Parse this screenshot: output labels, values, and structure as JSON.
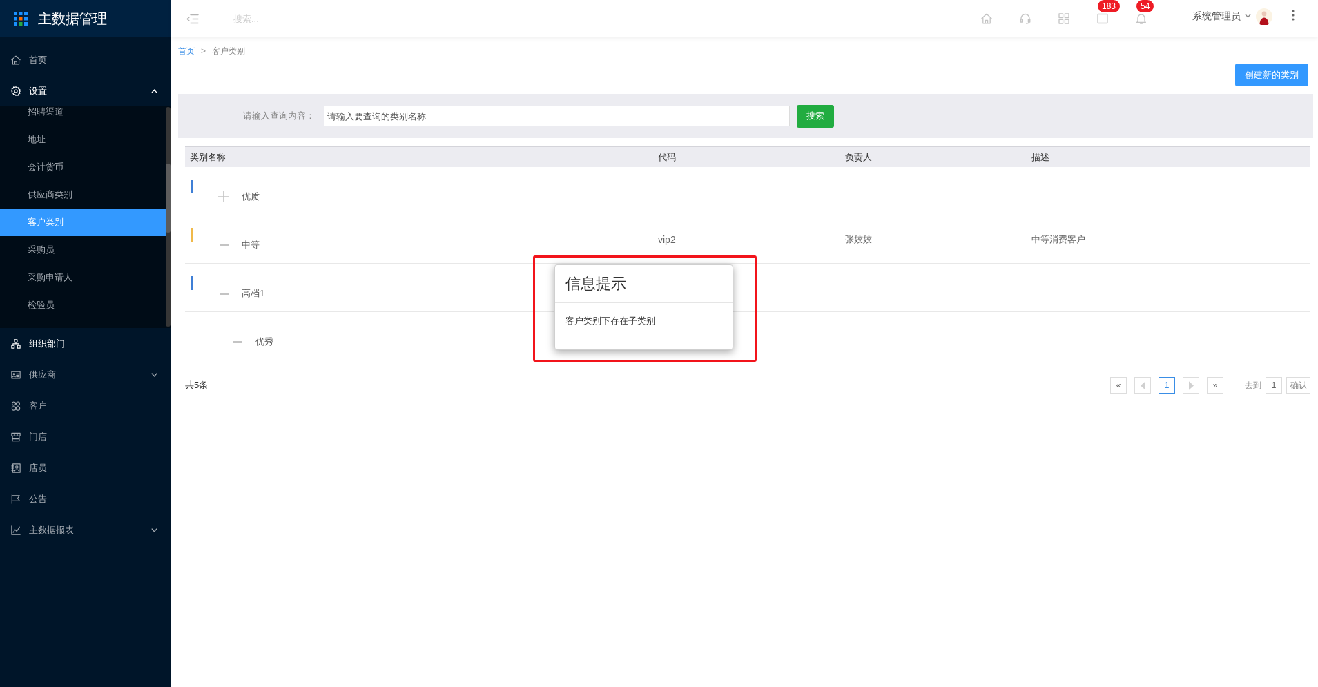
{
  "sidebar": {
    "title": "主数据管理",
    "menu": [
      {
        "label": "首页",
        "selected": false,
        "highlighted": false
      },
      {
        "label": "设置",
        "selected": false,
        "highlighted": true,
        "expanded": true,
        "children": [
          {
            "label": "招聘渠道",
            "selected": false
          },
          {
            "label": "地址",
            "selected": false
          },
          {
            "label": "会计货币",
            "selected": false
          },
          {
            "label": "供应商类别",
            "selected": false
          },
          {
            "label": "客户类别",
            "selected": true
          },
          {
            "label": "采购员",
            "selected": false
          },
          {
            "label": "采购申请人",
            "selected": false
          },
          {
            "label": "检验员",
            "selected": false
          }
        ]
      },
      {
        "label": "组织部门",
        "selected": false,
        "highlighted": true
      },
      {
        "label": "供应商",
        "selected": false,
        "highlighted": false,
        "expanded": false
      },
      {
        "label": "客户",
        "selected": false,
        "highlighted": false
      },
      {
        "label": "门店",
        "selected": false,
        "highlighted": false
      },
      {
        "label": "店员",
        "selected": false,
        "highlighted": false
      },
      {
        "label": "公告",
        "selected": false,
        "highlighted": false
      },
      {
        "label": "主数据报表",
        "selected": false,
        "highlighted": false,
        "expanded": false
      }
    ]
  },
  "topbar": {
    "search": {
      "placeholder": "搜索..."
    },
    "message_badge": "183",
    "notification_badge": "54",
    "user": {
      "name": "系统管理员"
    }
  },
  "breadcrumb": {
    "items": [
      {
        "label": "首页",
        "kind": "link"
      },
      {
        "label": "客户类别",
        "kind": "current"
      }
    ],
    "separator": ">"
  },
  "create_button": "创建新的类别",
  "search": {
    "label": "请输入查询内容：",
    "placeholder": "请输入要查询的类别名称",
    "button": "搜索"
  },
  "table": {
    "columns": [
      "类别名称",
      "代码",
      "负责人",
      "描述"
    ],
    "rows": [
      {
        "name": "优质",
        "color": "#3f7fd6",
        "expanded": false
      },
      {
        "name": "中等",
        "color": "#f0b94a",
        "expanded": true,
        "code": "vip2",
        "owner": "张姣姣",
        "description": "中等消费客户"
      },
      {
        "name": "高档1",
        "color": "#3f7fd6",
        "expanded": true,
        "children": [
          {
            "name": "优秀",
            "expanded": true
          }
        ]
      }
    ]
  },
  "footer": {
    "total": "共5条",
    "pagination": {
      "first": "«",
      "pages": [
        {
          "label": "1",
          "selected": true
        }
      ],
      "last": "»",
      "goto_label": "去到",
      "goto_value": "1",
      "confirm": "确认"
    }
  },
  "dialog": {
    "title": "信息提示",
    "message": "客户类别下存在子类别",
    "outlined": true
  }
}
